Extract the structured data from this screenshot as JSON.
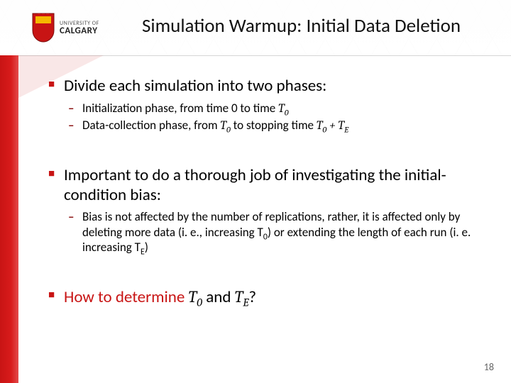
{
  "brand": {
    "top": "UNIVERSITY OF",
    "bottom": "CALGARY",
    "crest_fill": "#c81414",
    "crest_accent": "#f5b800"
  },
  "title": "Simulation Warmup: Initial Data Deletion",
  "bullets": {
    "b1": "Divide each simulation into two phases:",
    "b1a_pre": "Initialization phase, from time 0 to time ",
    "b1a_T": "T",
    "b1a_sub": "0",
    "b1b_pre": "Data-collection phase, from ",
    "b1b_T1": "T",
    "b1b_sub1": "0",
    "b1b_mid": " to stopping time ",
    "b1b_T2": "T",
    "b1b_sub2": "0",
    "b1b_plus": " + ",
    "b1b_T3": "T",
    "b1b_sub3": "E",
    "b2": "Important to do a thorough job of investigating the initial-condition bias:",
    "b2a_pre": "Bias is not affected by the number of replications, rather, it is affected only by deleting more data (i. e., increasing T",
    "b2a_sub1": "0",
    "b2a_mid": ") or extending the length of each run (i. e. increasing T",
    "b2a_sub2": "E",
    "b2a_post": ")",
    "b3_pre": "How to determine ",
    "b3_T1": "T",
    "b3_sub1": "0",
    "b3_and": " and ",
    "b3_T2": "T",
    "b3_sub2": "E",
    "b3_q": "?"
  },
  "page_number": "18"
}
